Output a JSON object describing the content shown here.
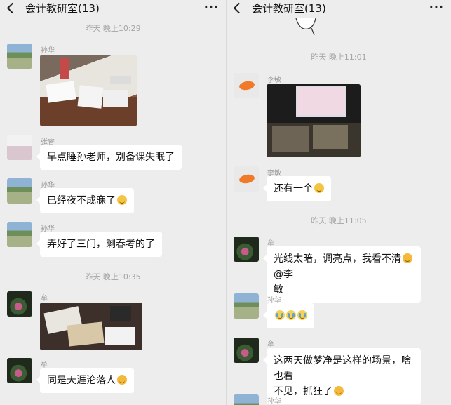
{
  "left": {
    "header": {
      "title": "会计教研室(13)",
      "more": "···"
    },
    "time1": "昨天 晚上10:29",
    "time2": "昨天 晚上10:35",
    "msgs": {
      "m1_name": "孙华",
      "m2_name": "张睿",
      "m2_text": "早点睡孙老师，别备课失眠了",
      "m3_name": "孙华",
      "m3_text": "已经夜不成寐了",
      "m4_name": "孙华",
      "m4_text": "弄好了三门，剩春考的了",
      "m5_name": "牟",
      "m6_name": "牟",
      "m6_text": "同是天涯沦落人"
    }
  },
  "right": {
    "header": {
      "title": "会计教研室(13)",
      "more": "···"
    },
    "time1": "昨天 晚上11:01",
    "time2": "昨天 晚上11:05",
    "msgs": {
      "r1_name": "李敏",
      "r2_name": "李敏",
      "r2_text": "还有一个",
      "r3_name": "牟",
      "r3_line1": "光线太暗，调亮点，我看不清",
      "r3_mention": "@李",
      "r3_line2": "敏",
      "r4_name": "孙华",
      "r5_name": "牟",
      "r5_line1": "这两天做梦净是这样的场景，啥也看",
      "r5_line2": "不见，抓狂了",
      "r6_name": "孙华"
    }
  },
  "icons": {
    "back": "chevron-left-icon",
    "more": "more-dots-icon",
    "emoji_think": "thinking-face-icon",
    "emoji_cry": "crying-face-icon",
    "emoji_grin": "grinning-sweat-face-icon"
  },
  "colors": {
    "background": "#ededed",
    "bubble": "#ffffff",
    "timestamp": "#a5a5a5"
  }
}
